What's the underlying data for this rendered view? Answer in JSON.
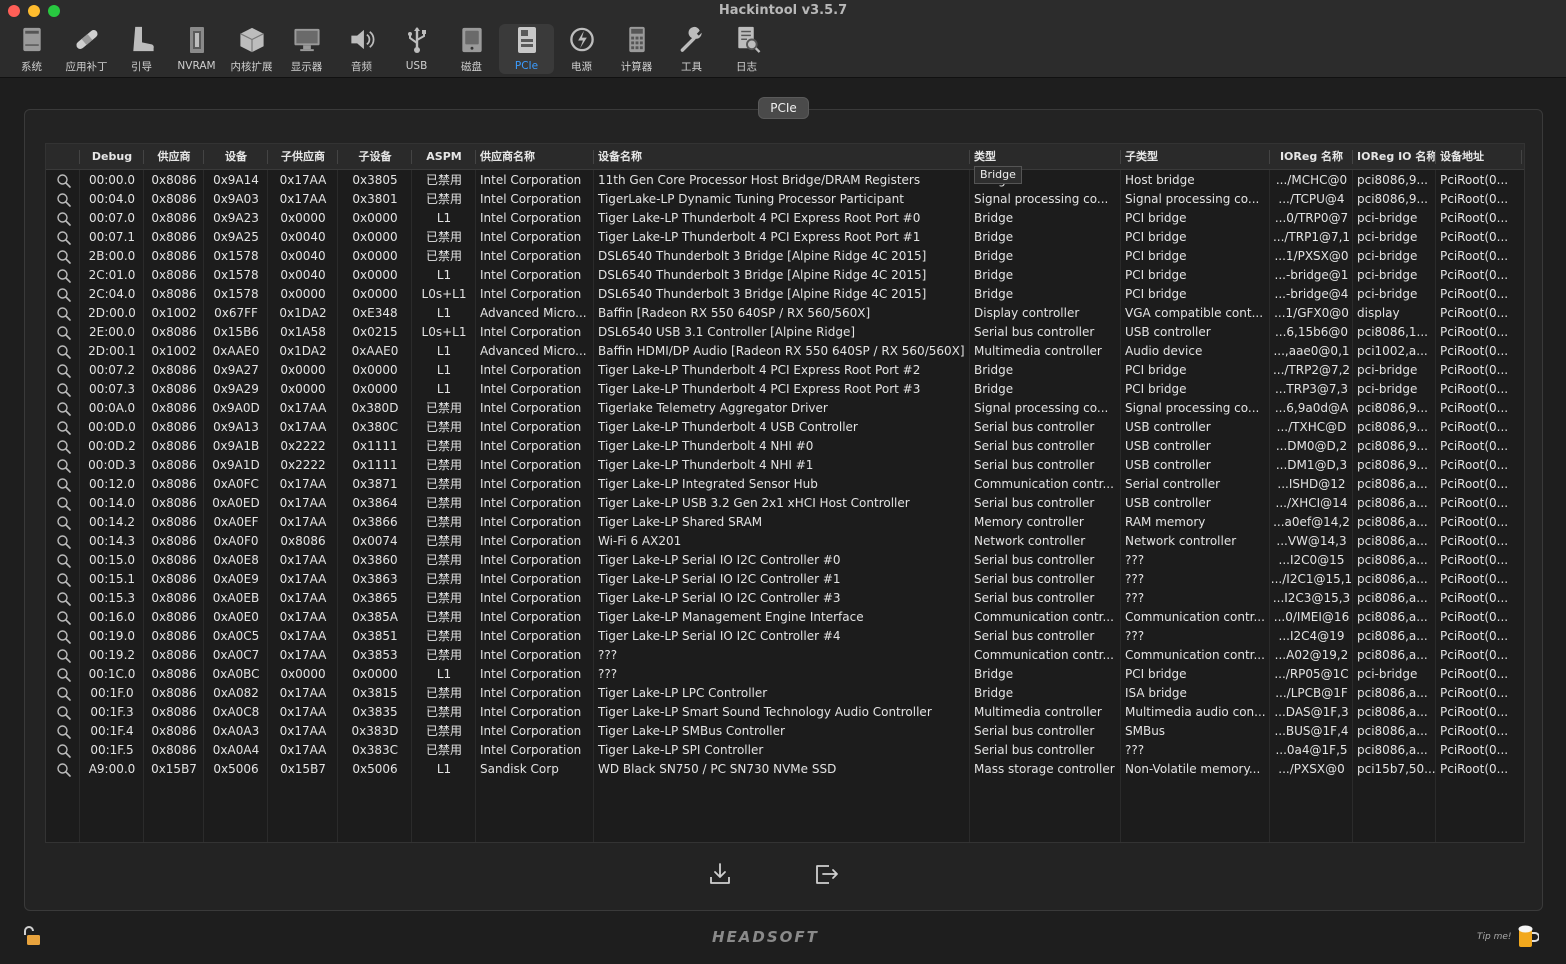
{
  "window": {
    "title": "Hackintool v3.5.7"
  },
  "toolbar": [
    {
      "id": "system",
      "label": "系统",
      "icon": "computer-icon"
    },
    {
      "id": "patch",
      "label": "应用补丁",
      "icon": "bandage-icon"
    },
    {
      "id": "boot",
      "label": "引导",
      "icon": "boot-icon"
    },
    {
      "id": "nvram",
      "label": "NVRAM",
      "icon": "nvram-chip-icon"
    },
    {
      "id": "kext",
      "label": "内核扩展",
      "icon": "package-icon"
    },
    {
      "id": "display",
      "label": "显示器",
      "icon": "monitor-icon"
    },
    {
      "id": "audio",
      "label": "音频",
      "icon": "speaker-icon"
    },
    {
      "id": "usb",
      "label": "USB",
      "icon": "usb-icon"
    },
    {
      "id": "disk",
      "label": "磁盘",
      "icon": "disk-icon"
    },
    {
      "id": "pcie",
      "label": "PCIe",
      "icon": "pcie-card-icon",
      "active": true
    },
    {
      "id": "power",
      "label": "电源",
      "icon": "power-icon"
    },
    {
      "id": "calc",
      "label": "计算器",
      "icon": "calculator-icon"
    },
    {
      "id": "tools",
      "label": "工具",
      "icon": "wrench-icon"
    },
    {
      "id": "log",
      "label": "日志",
      "icon": "log-icon"
    }
  ],
  "panel": {
    "tab_label": "PCIe"
  },
  "table": {
    "columns": [
      "",
      "Debug",
      "供应商",
      "设备",
      "子供应商",
      "子设备",
      "ASPM",
      "供应商名称",
      "设备名称",
      "类型",
      "子类型",
      "IOReg 名称",
      "IOReg IO 名称",
      "设备地址"
    ],
    "tooltip": "Bridge",
    "rows": [
      [
        "00:00.0",
        "0x8086",
        "0x9A14",
        "0x17AA",
        "0x3805",
        "已禁用",
        "Intel Corporation",
        "11th Gen Core Processor Host Bridge/DRAM Registers",
        "Bridge",
        "Host bridge",
        ".../MCHC@0",
        "pci8086,9...",
        "PciRoot(0..."
      ],
      [
        "00:04.0",
        "0x8086",
        "0x9A03",
        "0x17AA",
        "0x3801",
        "已禁用",
        "Intel Corporation",
        "TigerLake-LP Dynamic Tuning Processor Participant",
        "Signal processing co...",
        "Signal processing co...",
        ".../TCPU@4",
        "pci8086,9...",
        "PciRoot(0..."
      ],
      [
        "00:07.0",
        "0x8086",
        "0x9A23",
        "0x0000",
        "0x0000",
        "L1",
        "Intel Corporation",
        "Tiger Lake-LP Thunderbolt 4 PCI Express Root Port #0",
        "Bridge",
        "PCI bridge",
        "...0/TRP0@7",
        "pci-bridge",
        "PciRoot(0..."
      ],
      [
        "00:07.1",
        "0x8086",
        "0x9A25",
        "0x0040",
        "0x0000",
        "已禁用",
        "Intel Corporation",
        "Tiger Lake-LP Thunderbolt 4 PCI Express Root Port #1",
        "Bridge",
        "PCI bridge",
        ".../TRP1@7,1",
        "pci-bridge",
        "PciRoot(0..."
      ],
      [
        "2B:00.0",
        "0x8086",
        "0x1578",
        "0x0040",
        "0x0000",
        "已禁用",
        "Intel Corporation",
        "DSL6540 Thunderbolt 3 Bridge [Alpine Ridge 4C 2015]",
        "Bridge",
        "PCI bridge",
        "...1/PXSX@0",
        "pci-bridge",
        "PciRoot(0..."
      ],
      [
        "2C:01.0",
        "0x8086",
        "0x1578",
        "0x0040",
        "0x0000",
        "L1",
        "Intel Corporation",
        "DSL6540 Thunderbolt 3 Bridge [Alpine Ridge 4C 2015]",
        "Bridge",
        "PCI bridge",
        "...-bridge@1",
        "pci-bridge",
        "PciRoot(0..."
      ],
      [
        "2C:04.0",
        "0x8086",
        "0x1578",
        "0x0000",
        "0x0000",
        "L0s+L1",
        "Intel Corporation",
        "DSL6540 Thunderbolt 3 Bridge [Alpine Ridge 4C 2015]",
        "Bridge",
        "PCI bridge",
        "...-bridge@4",
        "pci-bridge",
        "PciRoot(0..."
      ],
      [
        "2D:00.0",
        "0x1002",
        "0x67FF",
        "0x1DA2",
        "0xE348",
        "L1",
        "Advanced Micro...",
        "Baffin [Radeon RX 550 640SP / RX 560/560X]",
        "Display controller",
        "VGA compatible cont...",
        "...1/GFX0@0",
        "display",
        "PciRoot(0..."
      ],
      [
        "2E:00.0",
        "0x8086",
        "0x15B6",
        "0x1A58",
        "0x0215",
        "L0s+L1",
        "Intel Corporation",
        "DSL6540 USB 3.1 Controller [Alpine Ridge]",
        "Serial bus controller",
        "USB controller",
        "...6,15b6@0",
        "pci8086,1...",
        "PciRoot(0..."
      ],
      [
        "2D:00.1",
        "0x1002",
        "0xAAE0",
        "0x1DA2",
        "0xAAE0",
        "L1",
        "Advanced Micro...",
        "Baffin HDMI/DP Audio [Radeon RX 550 640SP / RX 560/560X]",
        "Multimedia controller",
        "Audio device",
        "...,aae0@0,1",
        "pci1002,a...",
        "PciRoot(0..."
      ],
      [
        "00:07.2",
        "0x8086",
        "0x9A27",
        "0x0000",
        "0x0000",
        "L1",
        "Intel Corporation",
        "Tiger Lake-LP Thunderbolt 4 PCI Express Root Port #2",
        "Bridge",
        "PCI bridge",
        ".../TRP2@7,2",
        "pci-bridge",
        "PciRoot(0..."
      ],
      [
        "00:07.3",
        "0x8086",
        "0x9A29",
        "0x0000",
        "0x0000",
        "L1",
        "Intel Corporation",
        "Tiger Lake-LP Thunderbolt 4 PCI Express Root Port #3",
        "Bridge",
        "PCI bridge",
        "...TRP3@7,3",
        "pci-bridge",
        "PciRoot(0..."
      ],
      [
        "00:0A.0",
        "0x8086",
        "0x9A0D",
        "0x17AA",
        "0x380D",
        "已禁用",
        "Intel Corporation",
        "Tigerlake Telemetry Aggregator Driver",
        "Signal processing co...",
        "Signal processing co...",
        "...6,9a0d@A",
        "pci8086,9...",
        "PciRoot(0..."
      ],
      [
        "00:0D.0",
        "0x8086",
        "0x9A13",
        "0x17AA",
        "0x380C",
        "已禁用",
        "Intel Corporation",
        "Tiger Lake-LP Thunderbolt 4 USB Controller",
        "Serial bus controller",
        "USB controller",
        ".../TXHC@D",
        "pci8086,9...",
        "PciRoot(0..."
      ],
      [
        "00:0D.2",
        "0x8086",
        "0x9A1B",
        "0x2222",
        "0x1111",
        "已禁用",
        "Intel Corporation",
        "Tiger Lake-LP Thunderbolt 4 NHI #0",
        "Serial bus controller",
        "USB controller",
        "...DM0@D,2",
        "pci8086,9...",
        "PciRoot(0..."
      ],
      [
        "00:0D.3",
        "0x8086",
        "0x9A1D",
        "0x2222",
        "0x1111",
        "已禁用",
        "Intel Corporation",
        "Tiger Lake-LP Thunderbolt 4 NHI #1",
        "Serial bus controller",
        "USB controller",
        "...DM1@D,3",
        "pci8086,9...",
        "PciRoot(0..."
      ],
      [
        "00:12.0",
        "0x8086",
        "0xA0FC",
        "0x17AA",
        "0x3871",
        "已禁用",
        "Intel Corporation",
        "Tiger Lake-LP Integrated Sensor Hub",
        "Communication contr...",
        "Serial controller",
        "...ISHD@12",
        "pci8086,a...",
        "PciRoot(0..."
      ],
      [
        "00:14.0",
        "0x8086",
        "0xA0ED",
        "0x17AA",
        "0x3864",
        "已禁用",
        "Intel Corporation",
        "Tiger Lake-LP USB 3.2 Gen 2x1 xHCI Host Controller",
        "Serial bus controller",
        "USB controller",
        ".../XHCI@14",
        "pci8086,a...",
        "PciRoot(0..."
      ],
      [
        "00:14.2",
        "0x8086",
        "0xA0EF",
        "0x17AA",
        "0x3866",
        "已禁用",
        "Intel Corporation",
        "Tiger Lake-LP Shared SRAM",
        "Memory controller",
        "RAM memory",
        "...a0ef@14,2",
        "pci8086,a...",
        "PciRoot(0..."
      ],
      [
        "00:14.3",
        "0x8086",
        "0xA0F0",
        "0x8086",
        "0x0074",
        "已禁用",
        "Intel Corporation",
        "Wi-Fi 6 AX201",
        "Network controller",
        "Network controller",
        "...VW@14,3",
        "pci8086,a...",
        "PciRoot(0..."
      ],
      [
        "00:15.0",
        "0x8086",
        "0xA0E8",
        "0x17AA",
        "0x3860",
        "已禁用",
        "Intel Corporation",
        "Tiger Lake-LP Serial IO I2C Controller #0",
        "Serial bus controller",
        "???",
        "...I2C0@15",
        "pci8086,a...",
        "PciRoot(0..."
      ],
      [
        "00:15.1",
        "0x8086",
        "0xA0E9",
        "0x17AA",
        "0x3863",
        "已禁用",
        "Intel Corporation",
        "Tiger Lake-LP Serial IO I2C Controller #1",
        "Serial bus controller",
        "???",
        ".../I2C1@15,1",
        "pci8086,a...",
        "PciRoot(0..."
      ],
      [
        "00:15.3",
        "0x8086",
        "0xA0EB",
        "0x17AA",
        "0x3865",
        "已禁用",
        "Intel Corporation",
        "Tiger Lake-LP Serial IO I2C Controller #3",
        "Serial bus controller",
        "???",
        "...I2C3@15,3",
        "pci8086,a...",
        "PciRoot(0..."
      ],
      [
        "00:16.0",
        "0x8086",
        "0xA0E0",
        "0x17AA",
        "0x385A",
        "已禁用",
        "Intel Corporation",
        "Tiger Lake-LP Management Engine Interface",
        "Communication contr...",
        "Communication contr...",
        "...0/IMEI@16",
        "pci8086,a...",
        "PciRoot(0..."
      ],
      [
        "00:19.0",
        "0x8086",
        "0xA0C5",
        "0x17AA",
        "0x3851",
        "已禁用",
        "Intel Corporation",
        "Tiger Lake-LP Serial IO I2C Controller #4",
        "Serial bus controller",
        "???",
        "...I2C4@19",
        "pci8086,a...",
        "PciRoot(0..."
      ],
      [
        "00:19.2",
        "0x8086",
        "0xA0C7",
        "0x17AA",
        "0x3853",
        "已禁用",
        "Intel Corporation",
        "???",
        "Communication contr...",
        "Communication contr...",
        "...A02@19,2",
        "pci8086,a...",
        "PciRoot(0..."
      ],
      [
        "00:1C.0",
        "0x8086",
        "0xA0BC",
        "0x0000",
        "0x0000",
        "L1",
        "Intel Corporation",
        "???",
        "Bridge",
        "PCI bridge",
        ".../RP05@1C",
        "pci-bridge",
        "PciRoot(0..."
      ],
      [
        "00:1F.0",
        "0x8086",
        "0xA082",
        "0x17AA",
        "0x3815",
        "已禁用",
        "Intel Corporation",
        "Tiger Lake-LP LPC Controller",
        "Bridge",
        "ISA bridge",
        ".../LPCB@1F",
        "pci8086,a...",
        "PciRoot(0..."
      ],
      [
        "00:1F.3",
        "0x8086",
        "0xA0C8",
        "0x17AA",
        "0x3835",
        "已禁用",
        "Intel Corporation",
        "Tiger Lake-LP Smart Sound Technology Audio Controller",
        "Multimedia controller",
        "Multimedia audio con...",
        "...DAS@1F,3",
        "pci8086,a...",
        "PciRoot(0..."
      ],
      [
        "00:1F.4",
        "0x8086",
        "0xA0A3",
        "0x17AA",
        "0x383D",
        "已禁用",
        "Intel Corporation",
        "Tiger Lake-LP SMBus Controller",
        "Serial bus controller",
        "SMBus",
        "...BUS@1F,4",
        "pci8086,a...",
        "PciRoot(0..."
      ],
      [
        "00:1F.5",
        "0x8086",
        "0xA0A4",
        "0x17AA",
        "0x383C",
        "已禁用",
        "Intel Corporation",
        "Tiger Lake-LP SPI Controller",
        "Serial bus controller",
        "???",
        "...0a4@1F,5",
        "pci8086,a...",
        "PciRoot(0..."
      ],
      [
        "A9:00.0",
        "0x15B7",
        "0x5006",
        "0x15B7",
        "0x5006",
        "L1",
        "Sandisk Corp",
        "WD Black SN750 / PC SN730 NVMe SSD",
        "Mass storage controller",
        "Non-Volatile memory...",
        ".../PXSX@0",
        "pci15b7,50...",
        "PciRoot(0..."
      ]
    ]
  },
  "footer": {
    "logo": "HEADSOFT",
    "tip": "Tip me!"
  }
}
